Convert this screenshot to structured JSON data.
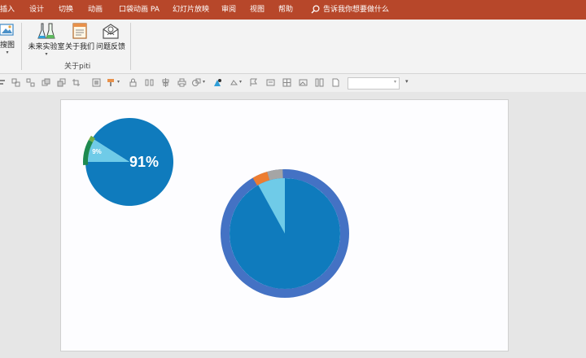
{
  "menu": {
    "items": [
      "插入",
      "设计",
      "切换",
      "动画",
      "口袋动画 PA",
      "幻灯片放映",
      "审阅",
      "视图",
      "帮助"
    ],
    "search_text": "告诉我你想要做什么"
  },
  "ribbon": {
    "partial_button_label": "搜图",
    "buttons": [
      {
        "label": "未来实验室",
        "icon": "flask-icon",
        "has_dropdown": true
      },
      {
        "label": "关于我们",
        "icon": "book-icon",
        "has_dropdown": false
      },
      {
        "label": "问题反馈",
        "icon": "feedback-icon",
        "has_dropdown": false
      }
    ],
    "group_label": "关于piti"
  },
  "colors": {
    "menubar": "#b7472a",
    "pie_main": "#0f7bbd",
    "pie_slice": "#6fcbe8",
    "ring_outer": "#4472c4",
    "ring_orange": "#ed7d31",
    "ring_gray": "#a5a5a5",
    "small_arc_green": "#70ad47",
    "small_arc_dark": "#1e8a50"
  },
  "chart_data": [
    {
      "type": "pie",
      "slices": [
        {
          "label": "91%",
          "value": 91
        },
        {
          "label": "9%",
          "value": 9
        }
      ]
    },
    {
      "type": "pie",
      "slices": [
        {
          "value": 92
        },
        {
          "value": 8
        }
      ]
    }
  ]
}
